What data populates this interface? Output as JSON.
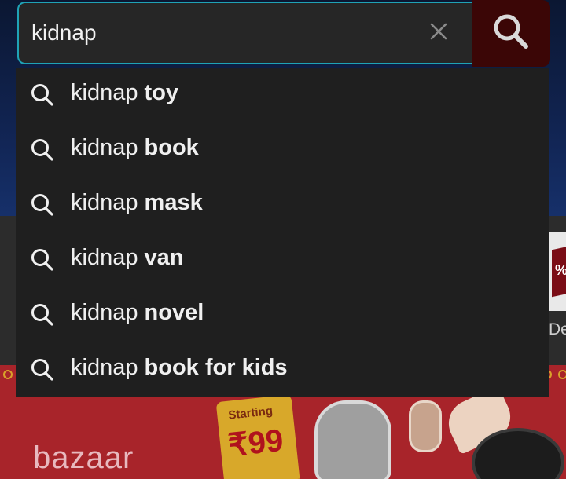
{
  "search": {
    "value": "kidnap",
    "clear_icon": "close-icon",
    "button_icon": "search-icon"
  },
  "suggestions": [
    {
      "base": "kidnap",
      "completion": "toy"
    },
    {
      "base": "kidnap",
      "completion": "book"
    },
    {
      "base": "kidnap",
      "completion": "mask"
    },
    {
      "base": "kidnap",
      "completion": "van"
    },
    {
      "base": "kidnap",
      "completion": "novel"
    },
    {
      "base": "kidnap",
      "completion": "book for kids"
    }
  ],
  "background": {
    "tile_percent": "%",
    "tile_label": "De",
    "promo_starting": "Starting",
    "promo_price": "₹99",
    "promo_text": "bazaar"
  },
  "colors": {
    "accent_border": "#1fa3b6",
    "search_button": "#3b0606",
    "dropdown_bg": "#1f1f1f",
    "promo_bg": "#a8242a"
  }
}
